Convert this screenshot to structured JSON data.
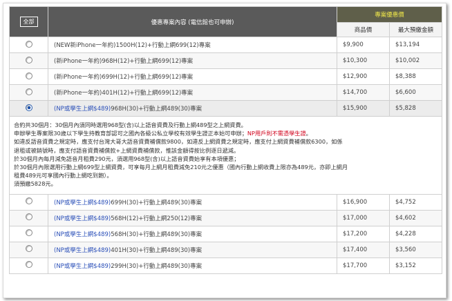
{
  "header": {
    "all_button": "全部",
    "plan_header": "優惠專案內容 (電信館也可申辦)",
    "price_header": "專案優惠價",
    "col_price": "商品價",
    "col_max": "最大預繳金額"
  },
  "rows_top": [
    {
      "np": "",
      "plan": "(NEW新iPhone一年約)1500H(12)+行動上網699(12)專案",
      "price": "$9,900",
      "max": "$13,194",
      "selected": false
    },
    {
      "np": "",
      "plan": "(新iPhone一年約)968H(12)+行動上網699(12)專案",
      "price": "$10,300",
      "max": "$10,002",
      "selected": false
    },
    {
      "np": "",
      "plan": "(新iPhone一年約)699H(12)+行動上網699(12)專案",
      "price": "$12,900",
      "max": "$8,388",
      "selected": false
    },
    {
      "np": "",
      "plan": "(新iPhone一年約)401H(12)+行動上網699(12)專案",
      "price": "$14,700",
      "max": "$6,600",
      "selected": false
    },
    {
      "np": "(NP或學生上網$489)",
      "plan": "968H(30)+行動上網489(30)專案",
      "price": "$15,900",
      "max": "$5,828",
      "selected": true
    }
  ],
  "detail": {
    "line1": "合約共30個月：30個月內須同時選用968型(含)以上語音資費及行動上網489型之上網資費。",
    "line2_a": "申辦學生專案限30歲以下學生持教育部認可之國內各級公私立學校有效學生證正本始可申辦；",
    "line2_red": "NP用戶則不需憑學生證",
    "line2_b": "。",
    "line3": "如違反語音資費之規定時，應支付台灣大哥大語音資費補償款9800，如違反上網資費之規定時，應支付上網資費補償款6300，如係",
    "line4": "退租或被銷號時，應支付語音資費補償款+上網資費補償款，惟該金額得按比例逐日遞減。",
    "line5": "於30個月內每月減免語音月租費290元，須選用968型(含)以上語音資費始享有本項優惠；",
    "line6": "於30個月內限選用行動上網699型上網資費，可享每月上網月租費減免210元之優惠（國內行動上網收費上限亦為489元，亦即上網月",
    "line7": "租費489元可享國內行動上網吃到飽）。",
    "line8": "須預繳5828元。"
  },
  "rows_bottom": [
    {
      "np": "(NP或學生上網$489)",
      "plan": "699H(30)+行動上網489(30)專案",
      "price": "$16,900",
      "max": "$4,752",
      "selected": false
    },
    {
      "np": "(NP或學生上網$489)",
      "plan": "568H(12)+行動上網250(12)專案",
      "price": "$17,000",
      "max": "$4,602",
      "selected": false
    },
    {
      "np": "(NP或學生上網$489)",
      "plan": "568H(30)+行動上網489(30)專案",
      "price": "$17,200",
      "max": "$4,228",
      "selected": false
    },
    {
      "np": "(NP或學生上網$489)",
      "plan": "401H(30)+行動上網489(30)專案",
      "price": "$17,400",
      "max": "$3,560",
      "selected": false
    },
    {
      "np": "(NP或學生上網$489)",
      "plan": "299H(30)+行動上網489(30)專案",
      "price": "$17,700",
      "max": "$3,152",
      "selected": false
    }
  ]
}
